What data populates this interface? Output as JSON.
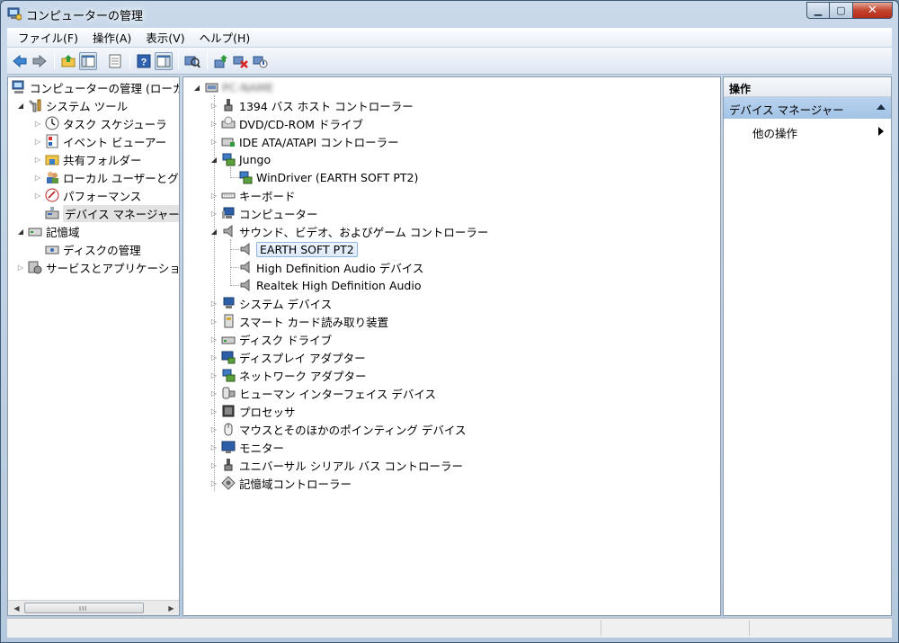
{
  "window": {
    "title": "コンピューターの管理"
  },
  "menu": [
    {
      "label": "ファイル(F)"
    },
    {
      "label": "操作(A)"
    },
    {
      "label": "表示(V)"
    },
    {
      "label": "ヘルプ(H)"
    }
  ],
  "toolbar": {
    "buttons": [
      {
        "name": "back-icon"
      },
      {
        "name": "forward-icon"
      },
      {
        "name": "up-folder-icon"
      },
      {
        "name": "show-tree-icon"
      },
      {
        "name": "properties-icon"
      },
      {
        "name": "help-icon"
      },
      {
        "name": "show-action-pane-icon"
      },
      {
        "name": "scan-hardware-icon"
      },
      {
        "name": "update-driver-icon"
      },
      {
        "name": "uninstall-icon"
      },
      {
        "name": "disable-device-icon"
      }
    ]
  },
  "left_tree": [
    {
      "label": "コンピューターの管理 (ローカ",
      "icon": "computer-management-icon"
    },
    {
      "label": "システム ツール",
      "icon": "system-tools-icon"
    },
    {
      "label": "タスク スケジューラ",
      "icon": "clock-icon"
    },
    {
      "label": "イベント ビューアー",
      "icon": "event-viewer-icon"
    },
    {
      "label": "共有フォルダー",
      "icon": "shared-folder-icon"
    },
    {
      "label": "ローカル ユーザーとグ",
      "icon": "users-icon"
    },
    {
      "label": "パフォーマンス",
      "icon": "performance-icon"
    },
    {
      "label": "デバイス マネージャー",
      "icon": "device-manager-icon"
    },
    {
      "label": "記憶域",
      "icon": "storage-icon"
    },
    {
      "label": "ディスクの管理",
      "icon": "disk-management-icon"
    },
    {
      "label": "サービスとアプリケーショ",
      "icon": "services-icon"
    }
  ],
  "device_tree": {
    "root": "PC-NAME",
    "items": [
      {
        "label": "1394 バス ホスト コントローラー",
        "icon": "usb-connector-icon"
      },
      {
        "label": "DVD/CD-ROM ドライブ",
        "icon": "dvd-drive-icon"
      },
      {
        "label": "IDE ATA/ATAPI コントローラー",
        "icon": "ide-controller-icon"
      },
      {
        "label": "Jungo",
        "icon": "network-device-icon"
      },
      {
        "label": "WinDriver (EARTH SOFT PT2)",
        "icon": "network-device-icon"
      },
      {
        "label": "キーボード",
        "icon": "keyboard-icon"
      },
      {
        "label": "コンピューター",
        "icon": "computer-icon"
      },
      {
        "label": "サウンド、ビデオ、およびゲーム コントローラー",
        "icon": "speaker-icon"
      },
      {
        "label": "EARTH SOFT PT2",
        "icon": "speaker-icon"
      },
      {
        "label": "High Definition Audio デバイス",
        "icon": "speaker-icon"
      },
      {
        "label": "Realtek High Definition Audio",
        "icon": "speaker-icon"
      },
      {
        "label": "システム デバイス",
        "icon": "computer-icon"
      },
      {
        "label": "スマート カード読み取り装置",
        "icon": "smart-card-icon"
      },
      {
        "label": "ディスク ドライブ",
        "icon": "disk-drive-icon"
      },
      {
        "label": "ディスプレイ アダプター",
        "icon": "display-adapter-icon"
      },
      {
        "label": "ネットワーク アダプター",
        "icon": "network-device-icon"
      },
      {
        "label": "ヒューマン インターフェイス デバイス",
        "icon": "hid-icon"
      },
      {
        "label": "プロセッサ",
        "icon": "processor-icon"
      },
      {
        "label": "マウスとそのほかのポインティング デバイス",
        "icon": "mouse-icon"
      },
      {
        "label": "モニター",
        "icon": "monitor-icon"
      },
      {
        "label": "ユニバーサル シリアル バス コントローラー",
        "icon": "usb-connector-icon"
      },
      {
        "label": "記憶域コントローラー",
        "icon": "storage-controller-icon"
      }
    ]
  },
  "actions": {
    "header": "操作",
    "section": "デバイス マネージャー",
    "item": "他の操作"
  },
  "scrollbar": {
    "grip": "III"
  }
}
